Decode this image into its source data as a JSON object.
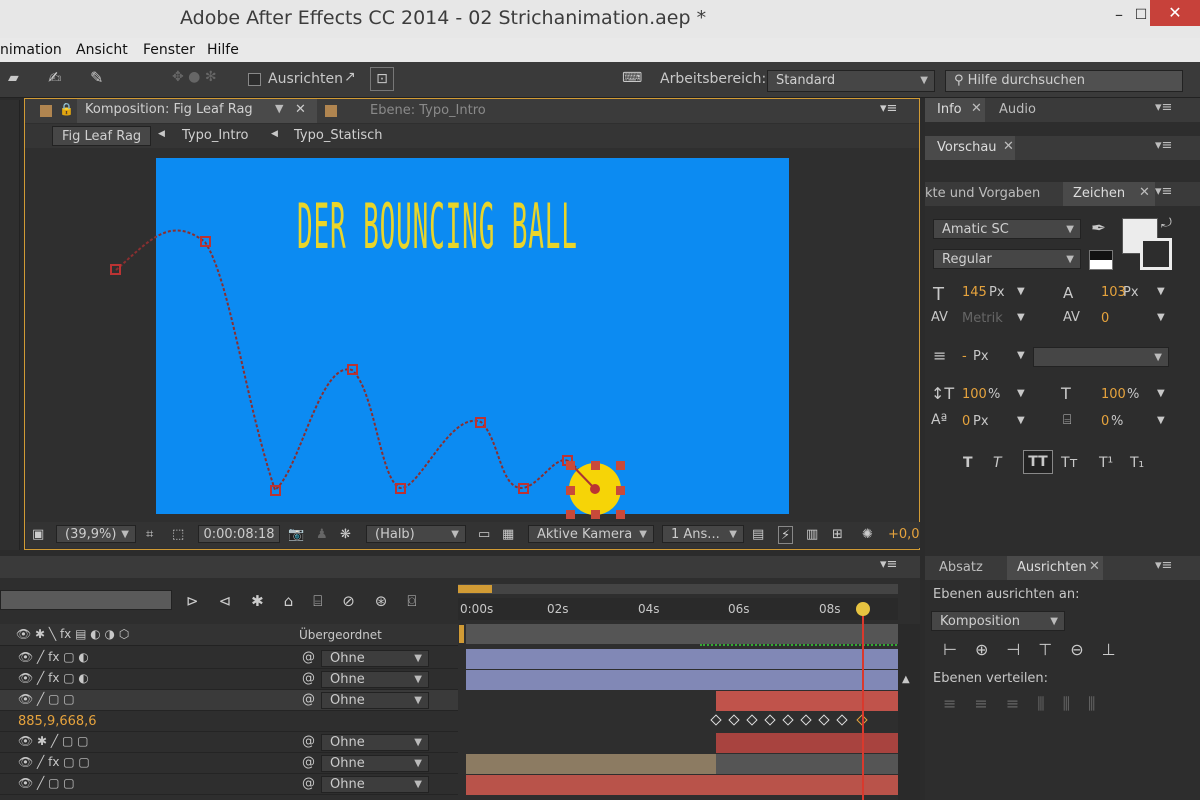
{
  "window": {
    "title": "Adobe After Effects CC 2014 - 02 Strichanimation.aep *",
    "min": "–",
    "max": "☐",
    "close": "✕"
  },
  "menu": [
    "nimation",
    "Ansicht",
    "Fenster",
    "Hilfe"
  ],
  "toolbar": {
    "ausrichten_label": "Ausrichten",
    "workspace_label": "Arbeitsbereich:",
    "workspace_value": "Standard",
    "search_placeholder": "Hilfe durchsuchen"
  },
  "comp_panel": {
    "tab_comp": "Komposition: Fig Leaf Rag",
    "tab_layer": "Ebene: Typo_Intro",
    "breadcrumbs": [
      "Fig Leaf Rag",
      "Typo_Intro",
      "Typo_Statisch"
    ],
    "headline": "DER BOUNCING BALL",
    "zoom": "(39,9%)",
    "timecode": "0:00:08:18",
    "resolution": "(Halb)",
    "camera": "Aktive Kamera",
    "views": "1 Ans...",
    "exposure": "+0,0"
  },
  "right_panel": {
    "tab_info": "Info",
    "tab_audio": "Audio",
    "tab_preview": "Vorschau",
    "tab_effects": "kte und Vorgaben",
    "tab_char": "Zeichen",
    "font_family": "Amatic SC",
    "font_style": "Regular",
    "font_size": "145",
    "font_size_unit": "Px",
    "leading": "103",
    "leading_unit": "Px",
    "kerning": "Metrik",
    "tracking": "0",
    "stroke": "-",
    "stroke_unit": "Px",
    "vscale": "100",
    "vscale_unit": "%",
    "hscale": "100",
    "hscale_unit": "%",
    "baseline": "0",
    "baseline_unit": "Px",
    "tsume": "0",
    "tsume_unit": "%",
    "tab_paragraph": "Absatz",
    "tab_align": "Ausrichten",
    "align_to_label": "Ebenen ausrichten an:",
    "align_to_value": "Komposition",
    "distribute_label": "Ebenen verteilen:"
  },
  "timeline": {
    "parent_header": "Übergeordnet",
    "ruler": [
      "0:00s",
      "02s",
      "04s",
      "06s",
      "08s"
    ],
    "parent_value": "Ohne",
    "position_value": "885,9,668,6",
    "style_glyphs": [
      "T",
      "T",
      "TT",
      "Tт",
      "T¹",
      "T₁"
    ]
  },
  "colors": {
    "canvas": "#0c8bf2",
    "headline": "#e9d52a",
    "ball": "#f6d407",
    "path": "#c0392b",
    "accent": "#e6a33d",
    "playhead": "#d9392d"
  }
}
